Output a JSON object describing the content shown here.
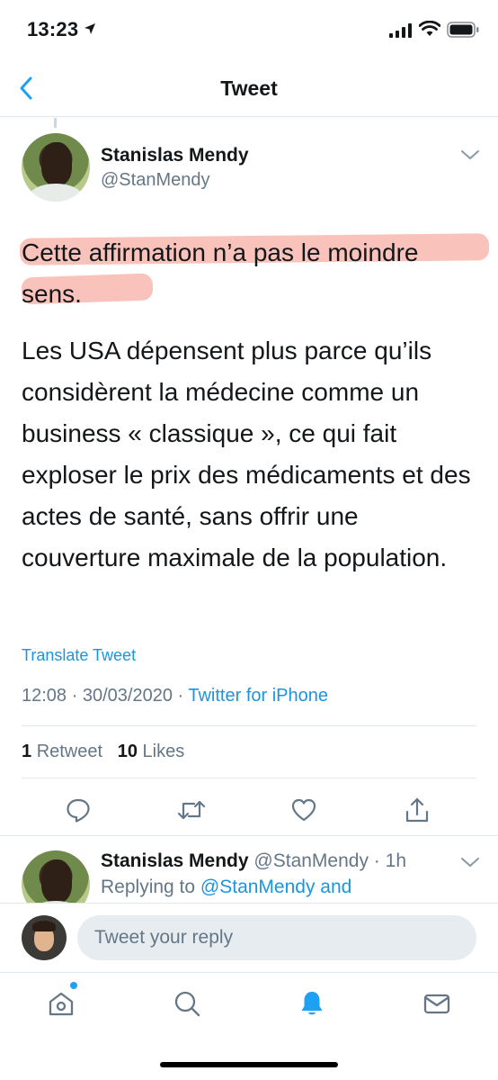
{
  "status_bar": {
    "time": "13:23"
  },
  "nav": {
    "title": "Tweet"
  },
  "tweet": {
    "author_name": "Stanislas Mendy",
    "author_handle": "@StanMendy",
    "paragraphs": [
      "Cette affirmation n’a pas le moindre sens.",
      "Les USA dépensent plus parce qu’ils considèrent la médecine comme un business « classique », ce qui fait exploser le prix des médicaments et des actes de santé, sans offrir une couverture maximale de la population."
    ],
    "translate_label": "Translate Tweet",
    "time": "12:08",
    "date": "30/03/2020",
    "source": "Twitter for iPhone",
    "retweet_count": "1",
    "retweet_label": "Retweet",
    "like_count": "10",
    "like_label": "Likes"
  },
  "reply": {
    "author_name": "Stanislas Mendy",
    "author_handle": "@StanMendy",
    "age": "1h",
    "replying_prefix": "Replying to",
    "replying_to": "@StanMendy and"
  },
  "composer": {
    "placeholder": "Tweet your reply"
  },
  "tabs": [
    "home-icon",
    "search-icon",
    "notifications-icon",
    "messages-icon"
  ],
  "colors": {
    "accent": "#1da1f2",
    "link": "#1b95e0",
    "secondary_text": "#657786",
    "highlight": "#f07060"
  }
}
